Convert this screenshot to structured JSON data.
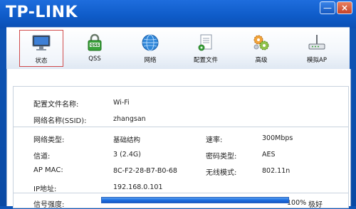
{
  "window": {
    "brand": "TP-LINK",
    "minimize_label": "—",
    "close_label": "×"
  },
  "toolbar": {
    "items": [
      {
        "label": "状态",
        "icon": "monitor-icon",
        "active": true
      },
      {
        "label": "QSS",
        "icon": "qss-lock-icon",
        "active": false
      },
      {
        "label": "网络",
        "icon": "globe-icon",
        "active": false
      },
      {
        "label": "配置文件",
        "icon": "profile-document-icon",
        "active": false
      },
      {
        "label": "高级",
        "icon": "gears-icon",
        "active": false
      },
      {
        "label": "模拟AP",
        "icon": "router-icon",
        "active": false
      }
    ]
  },
  "status": {
    "profile_name_label": "配置文件名称:",
    "profile_name_value": "Wi-Fi",
    "ssid_label": "网络名称(SSID):",
    "ssid_value": "zhangsan",
    "network_type_label": "网络类型:",
    "network_type_value": "基础结构",
    "rate_label": "速率:",
    "rate_value": "300Mbps",
    "channel_label": "信道:",
    "channel_value": "3 (2.4G)",
    "encryption_label": "密码类型:",
    "encryption_value": "AES",
    "ap_mac_label": "AP MAC:",
    "ap_mac_value": "8C-F2-28-B7-B0-68",
    "wireless_mode_label": "无线模式:",
    "wireless_mode_value": "802.11n",
    "ip_label": "IP地址:",
    "ip_value": "192.168.0.101",
    "signal_label": "信号强度:",
    "signal_percent_text": "100%",
    "signal_quality_text": "极好",
    "signal_level": 1.0
  },
  "colors": {
    "titlebar": "#0f5cc9",
    "active_border": "#d04a4a",
    "signal_bar": "#1d6fe0"
  }
}
